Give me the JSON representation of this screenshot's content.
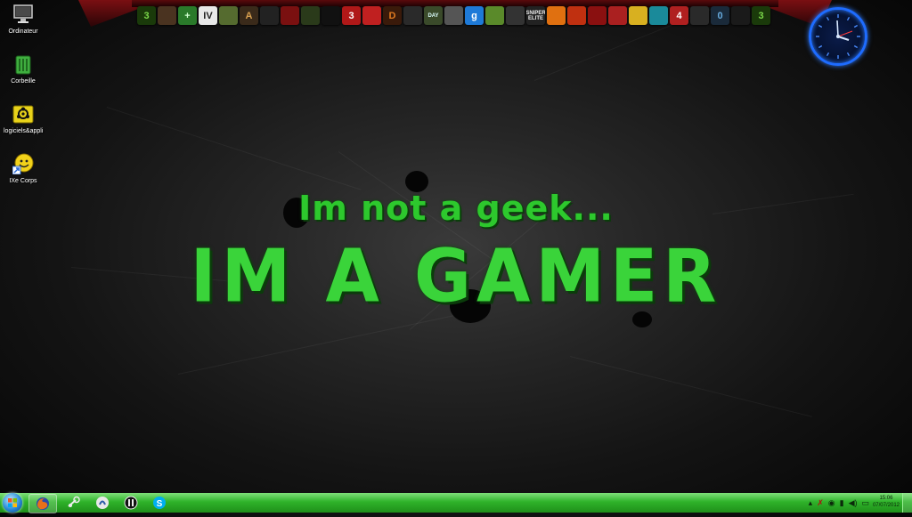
{
  "desktop": {
    "icons": [
      {
        "label": "Ordinateur",
        "icon": "computer-icon"
      },
      {
        "label": "Corbeille",
        "icon": "recycle-bin-icon"
      },
      {
        "label": "logiciels&appli",
        "icon": "biohazard-folder-icon"
      },
      {
        "label": "IXe Corps",
        "icon": "smiley-shortcut-icon"
      }
    ]
  },
  "wallpaper": {
    "line1": "Im not a geek...",
    "line2": "IM A GAMER"
  },
  "dock": {
    "items": [
      {
        "text": "3",
        "bg": "#1a3a0a",
        "fg": "#7ad84a",
        "icon": "half-life-3-icon"
      },
      {
        "text": "",
        "bg": "#4a3320",
        "fg": "#fff",
        "icon": "warrior-icon"
      },
      {
        "text": "+",
        "bg": "#2a7a2a",
        "fg": "#cfffcf",
        "icon": "green-cross-icon"
      },
      {
        "text": "IV",
        "bg": "#e8e8e8",
        "fg": "#222",
        "icon": "gta-iv-icon"
      },
      {
        "text": "",
        "bg": "#556b2f",
        "fg": "#fff",
        "icon": "battlefield-icon"
      },
      {
        "text": "A",
        "bg": "#3a2a1a",
        "fg": "#d8a050",
        "icon": "assassin-icon"
      },
      {
        "text": "",
        "bg": "#222",
        "fg": "#ccc",
        "icon": "skull-icon"
      },
      {
        "text": "",
        "bg": "#7a1010",
        "fg": "#fff",
        "icon": "red-faction-icon"
      },
      {
        "text": "",
        "bg": "#2a3a1a",
        "fg": "#9ad050",
        "icon": "crysis-icon"
      },
      {
        "text": "",
        "bg": "#111",
        "fg": "#ddd",
        "icon": "dark-game-icon"
      },
      {
        "text": "3",
        "bg": "#b01818",
        "fg": "#fff",
        "icon": "mass-effect-3-icon"
      },
      {
        "text": "",
        "bg": "#c02020",
        "fg": "#fff",
        "icon": "flag-icon"
      },
      {
        "text": "D",
        "bg": "#3a1a0a",
        "fg": "#e07a20",
        "icon": "diablo-icon"
      },
      {
        "text": "",
        "bg": "#2a2a2a",
        "fg": "#eee",
        "icon": "hooded-figure-icon"
      },
      {
        "text": "DAY",
        "bg": "#3a4a2a",
        "fg": "#dff",
        "icon": "dayz-icon"
      },
      {
        "text": "",
        "bg": "#555",
        "fg": "#ddd",
        "icon": "soldier-icon"
      },
      {
        "text": "g",
        "bg": "#1e7ad8",
        "fg": "#fff",
        "icon": "garrys-mod-icon"
      },
      {
        "text": "",
        "bg": "#5a8a2a",
        "fg": "#fff",
        "icon": "minecraft-icon"
      },
      {
        "text": "",
        "bg": "#333",
        "fg": "#eee",
        "icon": "winged-emblem-icon"
      },
      {
        "text": "SNIPER ELITE",
        "bg": "#222",
        "fg": "#eee",
        "icon": "sniper-elite-icon"
      },
      {
        "text": "",
        "bg": "#e07010",
        "fg": "#fff",
        "icon": "spiral-icon"
      },
      {
        "text": "",
        "bg": "#c03010",
        "fg": "#fff",
        "icon": "counter-strike-icon"
      },
      {
        "text": "",
        "bg": "#8a1010",
        "fg": "#fff",
        "icon": "crest-icon"
      },
      {
        "text": "",
        "bg": "#aa2020",
        "fg": "#fff",
        "icon": "shield-icon"
      },
      {
        "text": "",
        "bg": "#d8b020",
        "fg": "#300",
        "icon": "borderlands-icon"
      },
      {
        "text": "",
        "bg": "#1a8a9a",
        "fg": "#fff",
        "icon": "assassins-creed-icon"
      },
      {
        "text": "4",
        "bg": "#b02020",
        "fg": "#fff",
        "icon": "left-4-dead-icon"
      },
      {
        "text": "",
        "bg": "#2a2a2a",
        "fg": "#ccc",
        "icon": "skyrim-icon"
      },
      {
        "text": "0",
        "bg": "#1a2a3a",
        "fg": "#6ad",
        "icon": "portal-icon"
      },
      {
        "text": "",
        "bg": "#1a1a1a",
        "fg": "#999",
        "icon": "anchor-icon"
      },
      {
        "text": "3",
        "bg": "#1a3a0a",
        "fg": "#7ad84a",
        "icon": "half-life-3-end-icon"
      }
    ]
  },
  "taskbar": {
    "pinned": [
      {
        "icon": "firefox-icon"
      },
      {
        "icon": "steam-icon"
      },
      {
        "icon": "teamspeak-icon"
      },
      {
        "icon": "juventus-icon"
      },
      {
        "icon": "skype-icon"
      }
    ],
    "tray": [
      {
        "icon": "show-hidden-icons-icon",
        "glyph": "▴"
      },
      {
        "icon": "antivirus-icon",
        "glyph": "✗"
      },
      {
        "icon": "steam-tray-icon",
        "glyph": "◉"
      },
      {
        "icon": "network-icon",
        "glyph": "▮"
      },
      {
        "icon": "volume-icon",
        "glyph": "◀)"
      },
      {
        "icon": "battery-icon",
        "glyph": "▭"
      }
    ],
    "time": "15:06",
    "date": "07/07/2012"
  },
  "colors": {
    "slogan": "#2dc82d",
    "taskbar": "#2fb32a",
    "clock_ring": "#1e6cff"
  }
}
